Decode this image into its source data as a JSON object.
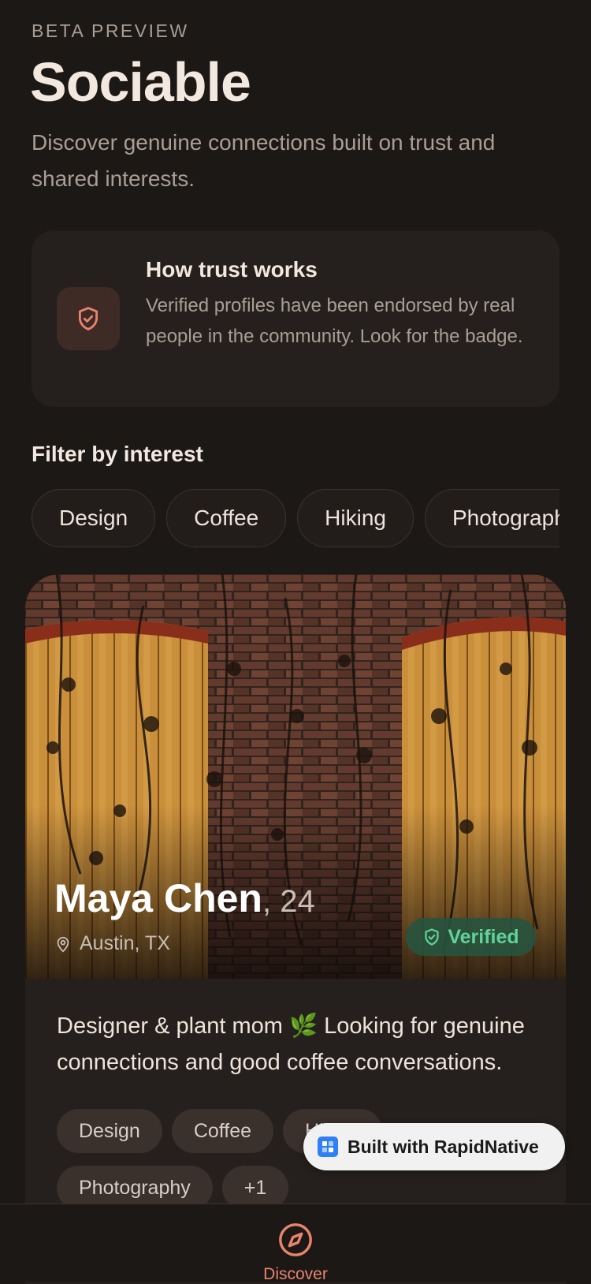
{
  "header": {
    "eyebrow": "BETA PREVIEW",
    "title": "Sociable",
    "subtitle": "Discover genuine connections built on trust and shared interests."
  },
  "trust": {
    "icon": "shield-check-icon",
    "title": "How trust works",
    "description": "Verified profiles have been endorsed by real people in the community. Look for the badge."
  },
  "filters": {
    "heading": "Filter by interest",
    "chips": [
      "Design",
      "Coffee",
      "Hiking",
      "Photography"
    ]
  },
  "profile": {
    "name": "Maya Chen",
    "age": ", 24",
    "location": "Austin, TX",
    "verified_label": "Verified",
    "bio": "Designer & plant mom 🌿 Looking for genuine connections and good coffee conversations.",
    "tags": [
      "Design",
      "Coffee",
      "Hiking",
      "Photography",
      "+1"
    ]
  },
  "badge": {
    "label": "Built with RapidNative"
  },
  "nav": {
    "discover_label": "Discover",
    "icon": "compass-icon"
  },
  "colors": {
    "background": "#1c1816",
    "accent": "#e8846c",
    "verified": "#5ed39a",
    "card": "#25201e"
  }
}
